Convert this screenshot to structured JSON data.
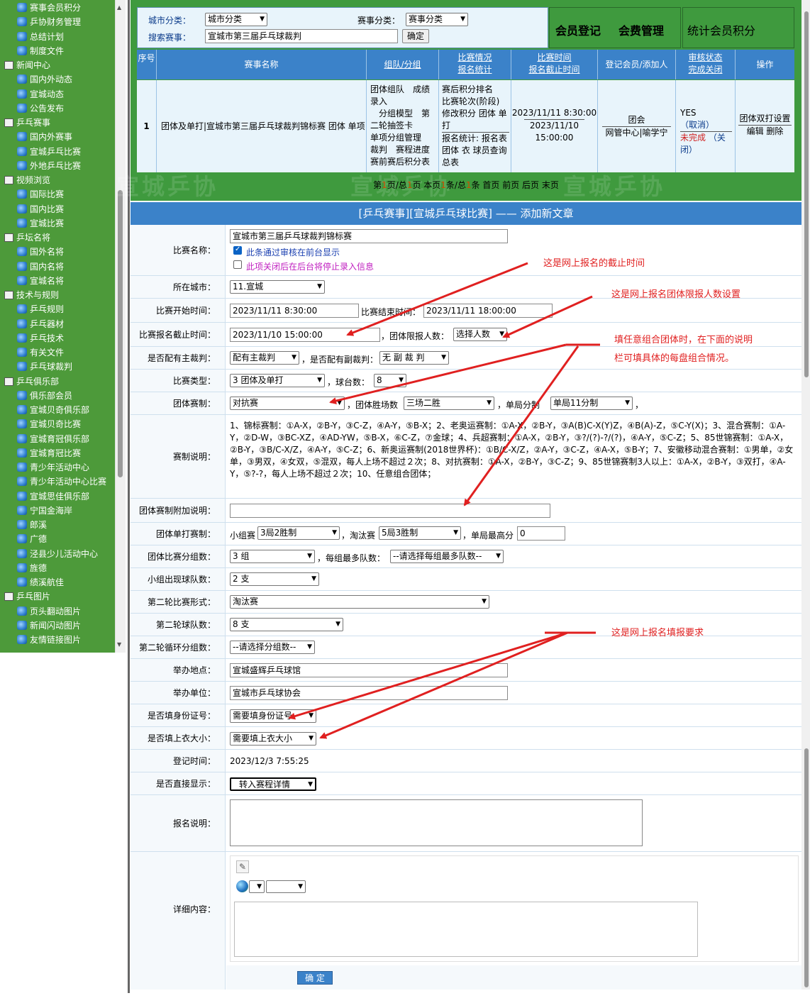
{
  "sidebar": {
    "rows": [
      {
        "label": "赛事会员积分",
        "type": "item"
      },
      {
        "label": "乒协财务管理",
        "type": "item"
      },
      {
        "label": "总结计划",
        "type": "item"
      },
      {
        "label": "制度文件",
        "type": "item"
      },
      {
        "label": "新闻中心",
        "type": "cat"
      },
      {
        "label": "国内外动态",
        "type": "item"
      },
      {
        "label": "宣城动态",
        "type": "item"
      },
      {
        "label": "公告发布",
        "type": "item"
      },
      {
        "label": "乒乓赛事",
        "type": "cat"
      },
      {
        "label": "国内外赛事",
        "type": "item"
      },
      {
        "label": "宣城乒乓比赛",
        "type": "item"
      },
      {
        "label": "外地乒乓比赛",
        "type": "item"
      },
      {
        "label": "视频浏览",
        "type": "cat"
      },
      {
        "label": "国际比赛",
        "type": "item"
      },
      {
        "label": "国内比赛",
        "type": "item"
      },
      {
        "label": "宣城比赛",
        "type": "item"
      },
      {
        "label": "乒坛名将",
        "type": "cat"
      },
      {
        "label": "国外名将",
        "type": "item"
      },
      {
        "label": "国内名将",
        "type": "item"
      },
      {
        "label": "宣城名将",
        "type": "item"
      },
      {
        "label": "技术与规则",
        "type": "cat"
      },
      {
        "label": "乒乓规则",
        "type": "item"
      },
      {
        "label": "乒乓器材",
        "type": "item"
      },
      {
        "label": "乒乓技术",
        "type": "item"
      },
      {
        "label": "有关文件",
        "type": "item"
      },
      {
        "label": "乒乓球裁判",
        "type": "item"
      },
      {
        "label": "乒乓俱乐部",
        "type": "cat"
      },
      {
        "label": "俱乐部会员",
        "type": "item"
      },
      {
        "label": "宣城贝奇俱乐部",
        "type": "item"
      },
      {
        "label": "宣城贝奇比赛",
        "type": "item"
      },
      {
        "label": "宣城育冠俱乐部",
        "type": "item"
      },
      {
        "label": "宣城育冠比赛",
        "type": "item"
      },
      {
        "label": "青少年活动中心",
        "type": "item"
      },
      {
        "label": "青少年活动中心比赛",
        "type": "item"
      },
      {
        "label": "宣城思佳俱乐部",
        "type": "item"
      },
      {
        "label": "宁国金海岸",
        "type": "item"
      },
      {
        "label": "郎溪",
        "type": "item"
      },
      {
        "label": "广德",
        "type": "item"
      },
      {
        "label": "泾县少儿活动中心",
        "type": "item"
      },
      {
        "label": "旌德",
        "type": "item"
      },
      {
        "label": "绩溪航佳",
        "type": "item"
      },
      {
        "label": "乒乓图片",
        "type": "cat"
      },
      {
        "label": "页头翻动图片",
        "type": "item"
      },
      {
        "label": "新闻闪动图片",
        "type": "item"
      },
      {
        "label": "友情链接图片",
        "type": "item"
      }
    ]
  },
  "filter": {
    "city_label": "城市分类：",
    "city_value": "城市分类",
    "event_label": "赛事分类：",
    "event_value": "赛事分类",
    "search_label": "搜索赛事：",
    "search_value": "宣城市第三届乒乓球裁判",
    "confirm": "确定"
  },
  "top_links": {
    "member_register": "会员登记",
    "fee_manage": "会费管理",
    "stats": "统计会员积分"
  },
  "watermark": "宣城乒协",
  "table": {
    "headers": {
      "seq": "序号",
      "name": "赛事名称",
      "team": "组队/分组",
      "status_a": "比赛情况",
      "status_b": "报名统计",
      "time_a": "比赛时间",
      "time_b": "报名截止时间",
      "register": "登记会员/添加人",
      "audit_a": "审核状态",
      "audit_b": "完成关闭",
      "op": "操作"
    },
    "row": {
      "seq": "1",
      "name": "团体及单打|宣城市第三届乒乓球裁判锦标赛 团体 单项",
      "team_lines": [
        "团体组队　成绩录入",
        "　分组模型　第二轮抽签卡",
        "单项分组管理",
        "裁判　赛程进度",
        "赛前赛后积分表"
      ],
      "status_lines": [
        "赛后积分排名",
        "比赛轮次(阶段)",
        "修改积分 团体 单打",
        "报名统计: 报名表",
        "团体 衣 球员查询",
        "总表"
      ],
      "time_start": "2023/11/11 8:30:00",
      "time_deadline": "2023/11/10 15:00:00",
      "register_a": "团会",
      "register_b": "网管中心|喻学宁",
      "audit_yes": "YES",
      "audit_cancel": "（取消）",
      "audit_incomplete": "未完成",
      "audit_close": "（关闭）",
      "op_a": "团体双打设置",
      "op_b": "编辑 删除"
    }
  },
  "pager": {
    "text_parts": [
      "第",
      "1",
      "页/总",
      "1",
      "页 本页",
      "1",
      "条/总",
      "1",
      "条 首页 前页 后页 末页"
    ]
  },
  "form": {
    "title": "[乒乓赛事][宣城乒乓球比赛] —— 添加新文章",
    "name_label": "比赛名称：",
    "name_value": "宣城市第三届乒乓球裁判锦标赛",
    "check1": "此条通过审核在前台显示",
    "check2": "此项关闭后在后台将停止录入信息",
    "city_label": "所在城市：",
    "city_value": "11.宣城",
    "start_label": "比赛开始时间：",
    "start_value": "2023/11/11 8:30:00",
    "end_label": "比赛结束时间：",
    "end_value": "2023/11/11 18:00:00",
    "deadline_label": "比赛报名截止时间：",
    "deadline_value": "2023/11/10 15:00:00",
    "limit_label": "，团体限报人数：",
    "limit_value": "选择人数",
    "ref_label": "是否配有主裁判：",
    "ref_value": "配有主裁判",
    "vref_label": "，是否配有副裁判：",
    "vref_value": "无 副 裁 判",
    "type_label": "比赛类型：",
    "type_value": "3 团体及单打",
    "tables_label": "，球台数：",
    "tables_value": "8",
    "system_label": "团体赛制：",
    "system_value": "对抗赛",
    "win_label": "，团体胜场数",
    "win_value": "三场二胜",
    "score_label": "，单局分制",
    "score_value": "单局11分制",
    "trailing_comma": "，",
    "desc_label": "赛制说明：",
    "desc_text": "1、锦标赛制：①A-X，②B-Y，③C-Z，④A-Y，⑤B-X；2、老奥运赛制：①A-X，②B-Y，③A(B)C-X(Y)Z，④B(A)-Z，⑤C-Y(X)；3、混合赛制：①A-Y，②D-W，③BC-XZ，④AD-YW，⑤B-X，⑥C-Z，⑦金球；4、兵超赛制：①A-X，②B-Y，③?/(?)-?/(?)，④A-Y，⑤C-Z；5、85世锦赛制：①A-X，②B-Y，③B/C-X/Z，④A-Y，⑤C-Z；6、新奥运赛制(2018世界杯)：①B/C-X/Z，②A-Y，③C-Z，④A-X，⑤B-Y；7、安徽移动混合赛制：①男单，②女单，③男双，④女双，⑤混双，每人上场不超过２次；8、对抗赛制：①A-X，②B-Y，③C-Z；9、85世锦赛制3人以上：①A-X，②B-Y，③双打，④A-Y，⑤?-?，每人上场不超过２次；10、任意组合团体；",
    "extra_label": "团体赛制附加说明：",
    "single_label": "团体单打赛制：",
    "group_stage_label": "小组赛",
    "group_stage_value": "3局2胜制",
    "knockout_label": "，淘汰赛",
    "knockout_value": "5局3胜制",
    "max_label": "，单局最高分",
    "max_value": "0",
    "groups_label": "团体比赛分组数：",
    "groups_value": "3 组",
    "maxteams_label": "，每组最多队数：",
    "maxteams_value": "--请选择每组最多队数--",
    "qualify_label": "小组出现球队数：",
    "qualify_value": "2 支",
    "round2_form_label": "第二轮比赛形式：",
    "round2_form_value": "淘汰赛",
    "round2_teams_label": "第二轮球队数：",
    "round2_teams_value": "8 支",
    "round2_groups_label": "第二轮循环分组数：",
    "round2_groups_value": "--请选择分组数--",
    "venue_label": "举办地点：",
    "venue_value": "宣城盛辉乒乓球馆",
    "host_label": "举办单位：",
    "host_value": "宣城市乒乓球协会",
    "id_label": "是否填身份证号：",
    "id_value": "需要填身份证号",
    "shirt_label": "是否填上衣大小：",
    "shirt_value": "需要填上衣大小",
    "regtime_label": "登记时间：",
    "regtime_value": "2023/12/3 7:55:25",
    "direct_label": "是否直接显示：",
    "direct_value": "转入赛程详情",
    "signup_label": "报名说明：",
    "detail_label": "详细内容：",
    "submit": "确 定"
  },
  "annotations": {
    "a1": "这是网上报名的截止时间",
    "a2": "这是网上报名团体限报人数设置",
    "a3a": "填任意组合团体时，在下面的说明",
    "a3b": "栏可填具体的每盘组合情况。",
    "a4": "这是网上报名填报要求"
  },
  "colors": {
    "sidebar_bg": "#4d9a3a",
    "header_blue": "#3b82c9",
    "annotation_red": "#e02020",
    "panel_green": "#3f9a3e"
  }
}
